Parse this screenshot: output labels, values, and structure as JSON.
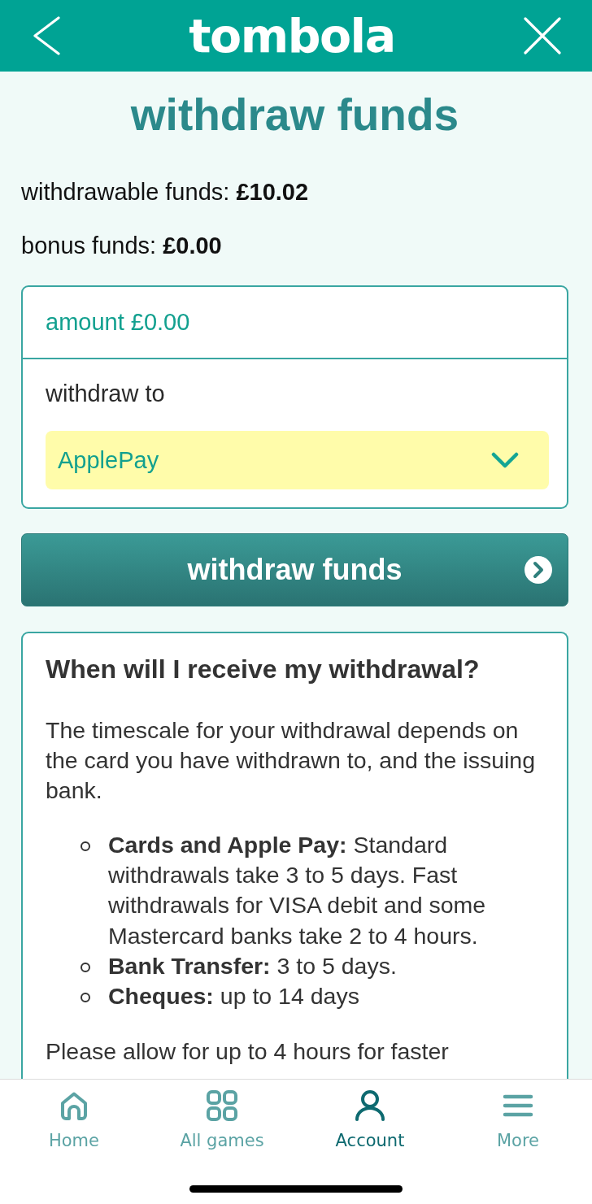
{
  "header": {
    "logo": "tombola"
  },
  "page_title": "withdraw funds",
  "balances": [
    "withdrawable funds: **£10.02**",
    "bonus funds: **£0.00**"
  ],
  "form": {
    "amount": {
      "placeholder": "amount £0.00"
    },
    "withdraw_to": {
      "label": "withdraw to",
      "value": "ApplePay"
    }
  },
  "submit_button": {
    "label": "withdraw funds"
  },
  "info": {
    "heading": "When will I receive my withdrawal?",
    "intro": "The timescale for your withdrawal depends on the card you have withdrawn to, and the issuing bank.",
    "items": [
      "**Cards and Apple Pay:** Standard withdrawals take 3 to 5 days. Fast withdrawals for VISA debit and some Mastercard banks take 2 to 4 hours.",
      "**Bank Transfer:** 3 to 5 days.",
      "**Cheques:** up to 14 days"
    ],
    "note": "Please allow for up to 4 hours for faster"
  },
  "nav": {
    "items": [
      {
        "label": "Home",
        "selected": false
      },
      {
        "label": "All games",
        "selected": false
      },
      {
        "label": "Account",
        "selected": true
      },
      {
        "label": "More",
        "selected": false
      }
    ]
  }
}
